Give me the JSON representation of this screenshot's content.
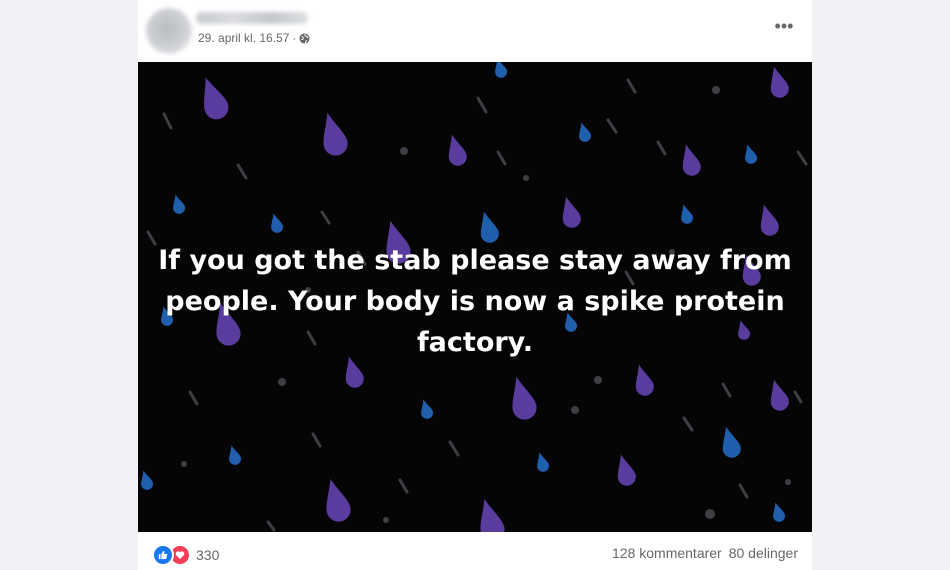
{
  "post": {
    "timestamp": "29. april kl. 16.57",
    "separator": "·",
    "privacy_icon": "globe-icon",
    "more_label": "•••",
    "image_text": "If you got the stab please stay away from\npeople. Your body is now a spike protein\nfactory.",
    "colors": {
      "background": "#050506",
      "purple": "#5b3aa0",
      "blue": "#1f5ea8",
      "gray": "#4a4a4f"
    }
  },
  "footer": {
    "reaction_icons": [
      "like-icon",
      "love-icon"
    ],
    "reaction_count": "330",
    "comments": "128 kommentarer",
    "shares": "80 delinger"
  }
}
